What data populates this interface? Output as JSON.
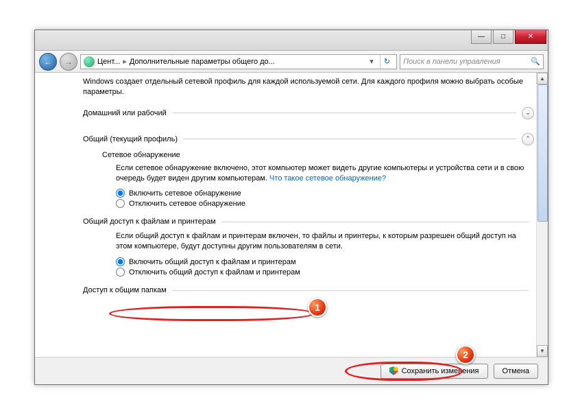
{
  "titlebar": {
    "min": "—",
    "max": "□",
    "close": "✕"
  },
  "nav": {
    "crumb1": "Цент...",
    "crumb2": "Дополнительные параметры общего до...",
    "search_placeholder": "Поиск в панели управления"
  },
  "intro": "Windows создает отдельный сетевой профиль для каждой используемой сети. Для каждого профиля можно выбрать особые параметры.",
  "profiles": {
    "home": "Домашний или рабочий",
    "public": "Общий (текущий профиль)"
  },
  "network_discovery": {
    "title": "Сетевое обнаружение",
    "desc_a": "Если сетевое обнаружение включено, этот компьютер может видеть другие компьютеры и устройства сети и в свою очередь будет виден другим компьютерам. ",
    "link": "Что такое сетевое обнаружение?",
    "on": "Включить сетевое обнаружение",
    "off": "Отключить сетевое обнаружение"
  },
  "file_sharing": {
    "title": "Общий доступ к файлам и принтерам",
    "desc": "Если общий доступ к файлам и принтерам включен, то файлы и принтеры, к которым разрешен общий доступ на этом компьютере, будут доступны другим пользователям в сети.",
    "on": "Включить общий доступ к файлам и принтерам",
    "off": "Отключить общий доступ к файлам и принтерам"
  },
  "public_folders": {
    "title": "Доступ к общим папкам"
  },
  "buttons": {
    "save": "Сохранить изменения",
    "cancel": "Отмена"
  },
  "markers": {
    "one": "1",
    "two": "2"
  }
}
